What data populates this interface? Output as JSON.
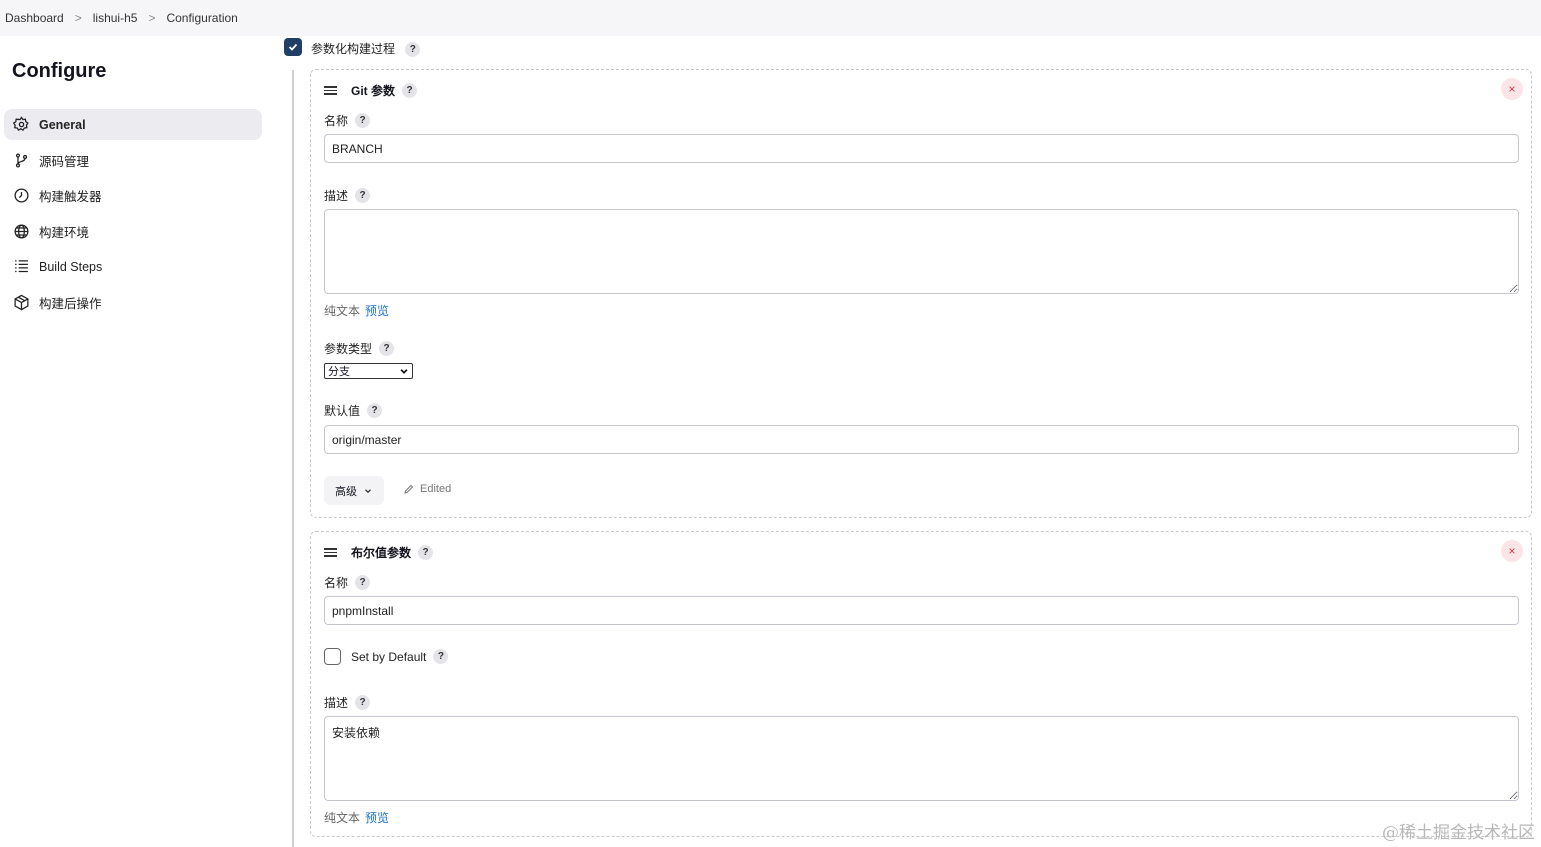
{
  "breadcrumb": {
    "items": [
      "Dashboard",
      "lishui-h5",
      "Configuration"
    ],
    "separator": ">"
  },
  "sidebar": {
    "title": "Configure",
    "items": [
      {
        "label": "General",
        "icon": "gear-icon",
        "active": true
      },
      {
        "label": "源码管理",
        "icon": "git-branch-icon",
        "active": false
      },
      {
        "label": "构建触发器",
        "icon": "clock-icon",
        "active": false
      },
      {
        "label": "构建环境",
        "icon": "globe-icon",
        "active": false
      },
      {
        "label": "Build Steps",
        "icon": "list-icon",
        "active": false
      },
      {
        "label": "构建后操作",
        "icon": "package-icon",
        "active": false
      }
    ]
  },
  "parameterized": {
    "label": "参数化构建过程",
    "checked": true,
    "help": "?"
  },
  "git_param": {
    "title": "Git 参数",
    "close": "×",
    "name_label": "名称",
    "name_value": "BRANCH",
    "desc_label": "描述",
    "desc_value": "",
    "format_plain": "纯文本",
    "format_preview": "预览",
    "type_label": "参数类型",
    "type_value": "分支",
    "default_label": "默认值",
    "default_value": "origin/master",
    "advanced_label": "高级",
    "edited_label": "Edited"
  },
  "bool_param": {
    "title": "布尔值参数",
    "close": "×",
    "name_label": "名称",
    "name_value": "pnpmInstall",
    "default_checkbox_label": "Set by Default",
    "default_checked": false,
    "desc_label": "描述",
    "desc_value": "安装依赖",
    "format_plain": "纯文本",
    "format_preview": "预览"
  },
  "help_glyph": "?",
  "watermark": "@稀土掘金技术社区",
  "colors": {
    "accent": "#1f3f66",
    "link": "#1a73c9",
    "close_bg": "#fbe5e6",
    "close_fg": "#d4374a",
    "active_nav_bg": "#ececf0"
  }
}
